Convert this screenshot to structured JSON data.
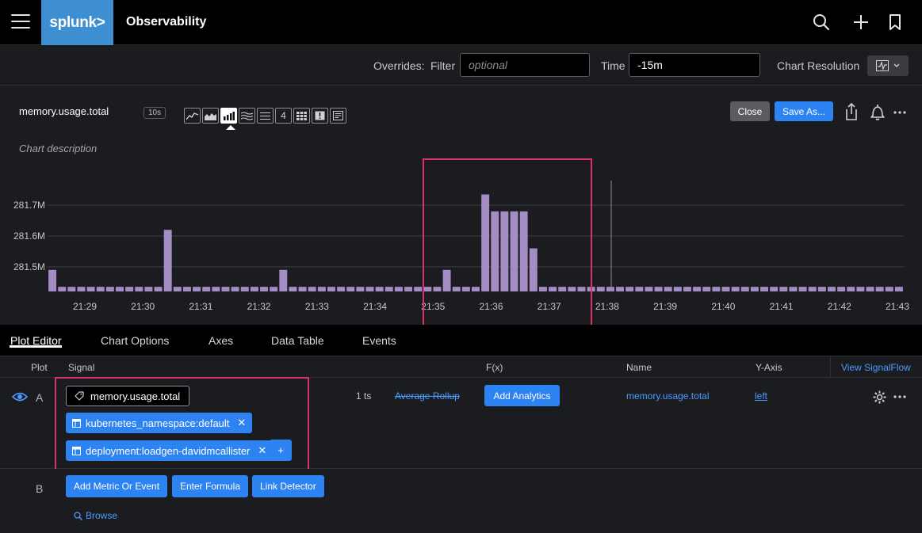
{
  "app": {
    "logo": "splunk>",
    "title": "Observability"
  },
  "overrides": {
    "label": "Overrides:",
    "filter_label": "Filter",
    "filter_placeholder": "optional",
    "time_label": "Time",
    "time_value": "-15m",
    "resolution_label": "Chart Resolution"
  },
  "chart_header": {
    "title": "memory.usage.total",
    "resolution_badge": "10s",
    "description_placeholder": "Chart description",
    "close_label": "Close",
    "save_label": "Save As...",
    "type_icons": [
      "line-chart-icon",
      "area-chart-icon",
      "column-chart-icon",
      "histogram-icon",
      "list-icon",
      "4",
      "heatmap-icon",
      "event-feed-icon",
      "text-icon"
    ],
    "active_type": "column-chart-icon"
  },
  "chart_data": {
    "type": "bar",
    "title": "",
    "xlabel": "",
    "ylabel": "",
    "ylim": [
      281.42,
      281.78
    ],
    "yticks": [
      281.5,
      281.6,
      281.7
    ],
    "ytick_labels": [
      "281.5M",
      "281.6M",
      "281.7M"
    ],
    "xtick_labels": [
      "21:29",
      "21:30",
      "21:31",
      "21:32",
      "21:33",
      "21:34",
      "21:35",
      "21:36",
      "21:37",
      "21:38",
      "21:39",
      "21:40",
      "21:41",
      "21:42",
      "21:43"
    ],
    "bar_color": "#a38dc4",
    "grid": true,
    "values": [
      281.49,
      281.435,
      281.435,
      281.435,
      281.435,
      281.435,
      281.435,
      281.435,
      281.435,
      281.435,
      281.435,
      281.435,
      281.62,
      281.435,
      281.435,
      281.435,
      281.435,
      281.435,
      281.435,
      281.435,
      281.435,
      281.435,
      281.435,
      281.435,
      281.49,
      281.435,
      281.435,
      281.435,
      281.435,
      281.435,
      281.435,
      281.435,
      281.435,
      281.435,
      281.435,
      281.435,
      281.435,
      281.435,
      281.435,
      281.435,
      281.435,
      281.49,
      281.435,
      281.435,
      281.435,
      281.735,
      281.68,
      281.68,
      281.68,
      281.68,
      281.56,
      281.435,
      281.435,
      281.435,
      281.435,
      281.435,
      281.435,
      281.435,
      281.435,
      281.435,
      281.435,
      281.435,
      281.435,
      281.435,
      281.435,
      281.435,
      281.435,
      281.435,
      281.435,
      281.435,
      281.435,
      281.435,
      281.435,
      281.435,
      281.435,
      281.435,
      281.435,
      281.435,
      281.435,
      281.435,
      281.435,
      281.435,
      281.435,
      281.435,
      281.435,
      281.435,
      281.435,
      281.435,
      281.435
    ]
  },
  "tabs": [
    "Plot Editor",
    "Chart Options",
    "Axes",
    "Data Table",
    "Events"
  ],
  "plot_editor": {
    "columns": {
      "plot": "Plot",
      "signal": "Signal",
      "fx": "F(x)",
      "name": "Name",
      "yaxis": "Y-Axis"
    },
    "view_signalflow": "View SignalFlow",
    "plot_a": {
      "letter": "A",
      "metric": "memory.usage.total",
      "filters": [
        "kubernetes_namespace:default",
        "deployment:loadgen-davidmcallister"
      ],
      "add_filter": "+",
      "ts_count": "1 ts",
      "rollup": "Average Rollup",
      "analytics_label": "Add Analytics",
      "name": "memory.usage.total",
      "yaxis": "left"
    },
    "plot_b": {
      "letter": "B",
      "add_metric": "Add Metric Or Event",
      "enter_formula": "Enter Formula",
      "link_detector": "Link Detector",
      "browse": "Browse"
    }
  }
}
